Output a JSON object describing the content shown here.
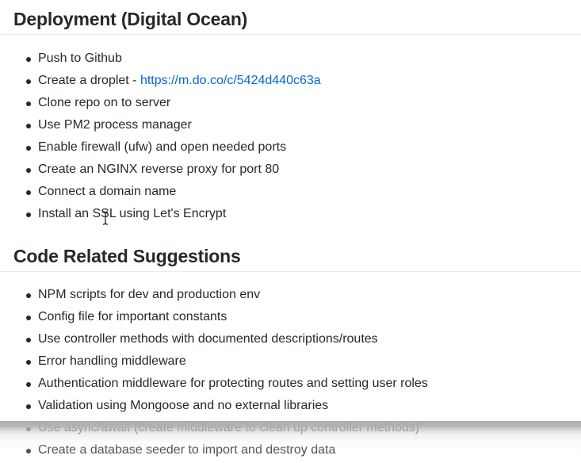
{
  "sections": [
    {
      "title": "Deployment (Digital Ocean)",
      "items": [
        {
          "text": "Push to Github"
        },
        {
          "text": "Create a droplet - ",
          "link": "https://m.do.co/c/5424d440c63a"
        },
        {
          "text": "Clone repo on to server"
        },
        {
          "text": "Use PM2 process manager"
        },
        {
          "text": "Enable firewall (ufw) and open needed ports"
        },
        {
          "text": "Create an NGINX reverse proxy for port 80"
        },
        {
          "text": "Connect a domain name"
        },
        {
          "text": "Install an SSL using Let's Encrypt"
        }
      ]
    },
    {
      "title": "Code Related Suggestions",
      "items": [
        {
          "text": "NPM scripts for dev and production env"
        },
        {
          "text": "Config file for important constants"
        },
        {
          "text": "Use controller methods with documented descriptions/routes"
        },
        {
          "text": "Error handling middleware"
        },
        {
          "text": "Authentication middleware for protecting routes and setting user roles"
        },
        {
          "text": "Validation using Mongoose and no external libraries"
        },
        {
          "text": "Use async/await (create middleware to clean up controller methods)"
        },
        {
          "text": "Create a database seeder to import and destroy data"
        }
      ]
    }
  ],
  "colors": {
    "text": "#24292e",
    "link": "#0366d6",
    "divider": "#eaecef"
  },
  "icons": {
    "cursor": "text-cursor-icon"
  }
}
